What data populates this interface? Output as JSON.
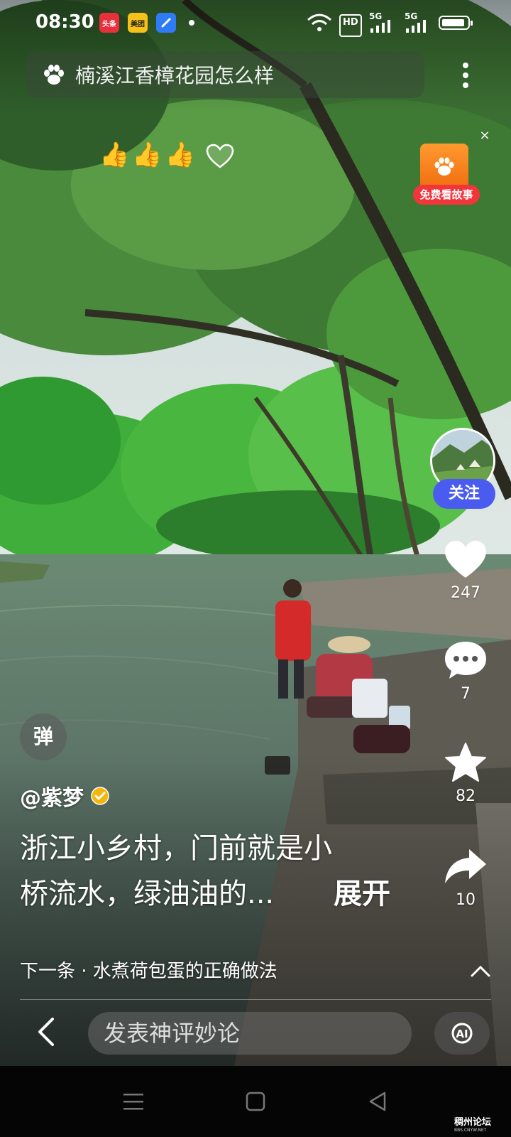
{
  "status_bar": {
    "time": "08:30",
    "app_badges": [
      {
        "label": "头条",
        "color": "#e8303a"
      },
      {
        "label": "美团",
        "color": "#f6c21a"
      },
      {
        "label": "",
        "color": "#2f7bf5"
      }
    ],
    "hd_label": "HD",
    "net1": "5G",
    "net2": "5G",
    "battery_level": 0.9
  },
  "search": {
    "query": "楠溪江香樟花园怎么样"
  },
  "reactions": {
    "emojis": [
      "👍",
      "👍",
      "👍"
    ]
  },
  "story_promo": {
    "label": "免费看故事",
    "close": "×"
  },
  "rail": {
    "follow_label": "关注",
    "likes": "247",
    "comments": "7",
    "favorites": "82",
    "shares": "10"
  },
  "danmaku": {
    "label": "弹"
  },
  "post": {
    "author": "@紫梦",
    "caption_line1": "浙江小乡村，门前就是小",
    "caption_line2": "桥流水，绿油油的...",
    "expand_label": "展开"
  },
  "next": {
    "label": "下一条 · 水煮荷包蛋的正确做法"
  },
  "comment_bar": {
    "placeholder": "发表神评妙论"
  },
  "watermark": {
    "title": "稠州论坛",
    "sub": "BBS.CNYW.NET"
  },
  "colors": {
    "follow": "#4a5cf0",
    "story_label": "#f2353b",
    "verified": "#f5b50a"
  }
}
